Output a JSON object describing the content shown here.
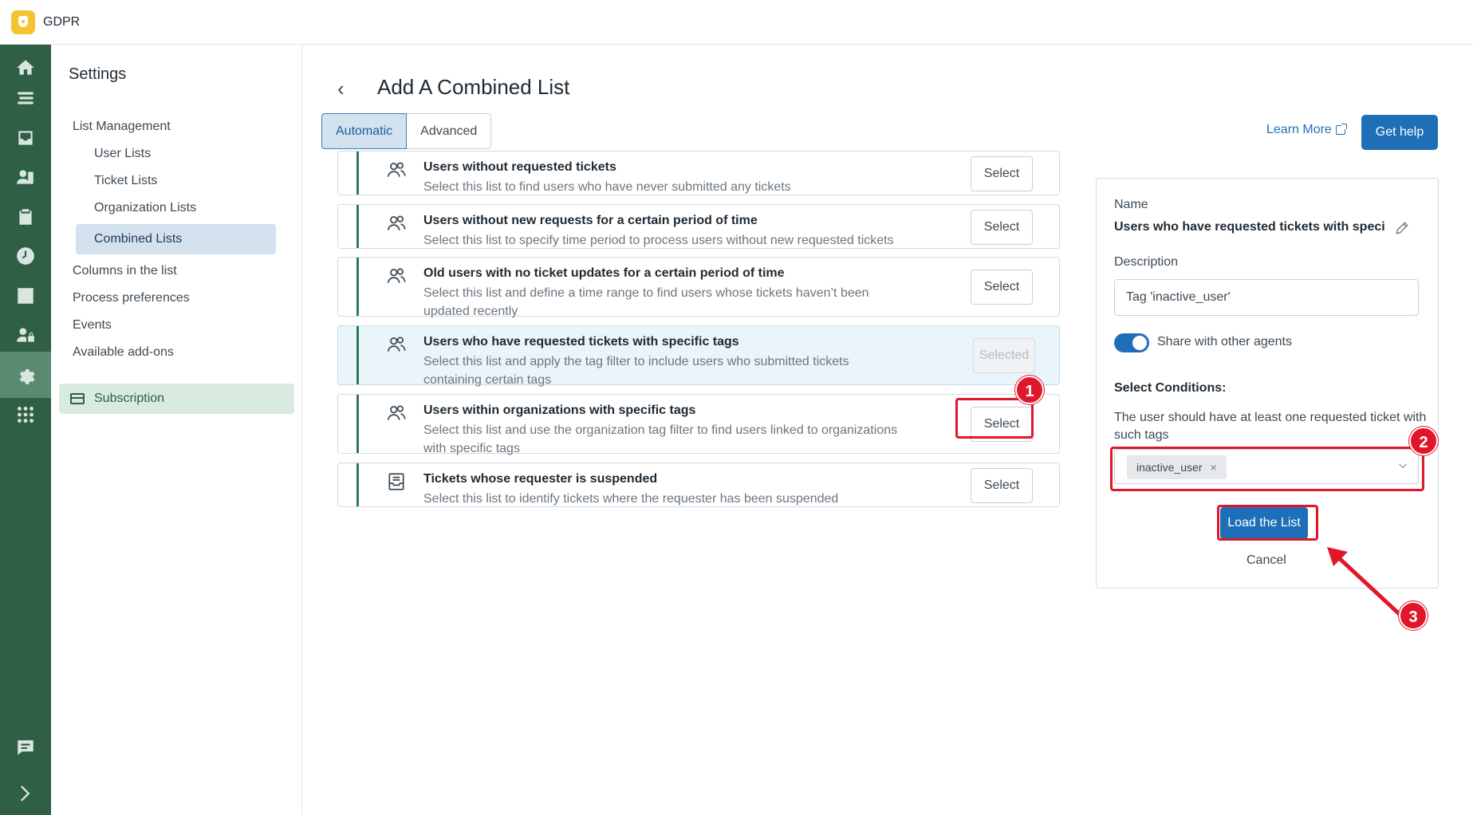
{
  "app": {
    "title": "GDPR"
  },
  "rail": {
    "items": [
      {
        "icon": "home-icon"
      },
      {
        "icon": "lists-icon"
      },
      {
        "icon": "inbox-icon"
      },
      {
        "icon": "users-icon"
      },
      {
        "icon": "clipboard-icon"
      },
      {
        "icon": "clock-icon"
      },
      {
        "icon": "chart-icon"
      },
      {
        "icon": "user-lock-icon"
      },
      {
        "icon": "gear-icon"
      },
      {
        "icon": "apps-grid-icon"
      },
      {
        "icon": "chat-icon"
      },
      {
        "icon": "expand-icon"
      }
    ]
  },
  "settings": {
    "title": "Settings",
    "items": {
      "list_management": "List Management",
      "user_lists": "User Lists",
      "ticket_lists": "Ticket Lists",
      "organization_lists": "Organization Lists",
      "combined_lists": "Combined Lists",
      "columns": "Columns in the list",
      "process_preferences": "Process preferences",
      "events": "Events",
      "addons": "Available add-ons",
      "subscription": "Subscription"
    }
  },
  "page": {
    "back": "‹",
    "title": "Add A Combined List",
    "tabs": [
      "Automatic",
      "Advanced"
    ],
    "learn_more": "Learn More",
    "get_help": "Get help"
  },
  "lists": [
    {
      "title": "Users without requested tickets",
      "desc": "Select this list to find users who have never submitted any tickets",
      "button": "Select",
      "icon": "users-icon"
    },
    {
      "title": "Users without new requests for a certain period of time",
      "desc": "Select this list to specify time period to process users without new requested tickets",
      "button": "Select",
      "icon": "users-icon"
    },
    {
      "title": "Old users with no ticket updates for a certain period of time",
      "desc": "Select this list and define a time range to find users whose tickets haven’t been updated recently",
      "button": "Select",
      "icon": "users-icon"
    },
    {
      "title": "Users who have requested tickets with specific tags",
      "desc": "Select this list and apply the tag filter to include users who submitted tickets containing certain tags",
      "button": "Selected",
      "icon": "users-icon"
    },
    {
      "title": "Users within organizations with specific tags",
      "desc": "Select this list and use the organization tag filter to find users linked to organizations with specific tags",
      "button": "Select",
      "icon": "users-icon"
    },
    {
      "title": "Tickets whose requester is suspended",
      "desc": "Select this list to identify tickets where the requester has been suspended",
      "button": "Select",
      "icon": "ticket-icon"
    }
  ],
  "panel": {
    "name_label": "Name",
    "name_value": "Users who have requested tickets with specifi...",
    "description_label": "Description",
    "description_value": "Tag 'inactive_user'",
    "share_label": "Share with other agents",
    "share_on": true,
    "conditions_title": "Select Conditions:",
    "conditions_desc": "The user should have at least one requested ticket with such tags",
    "tag": "inactive_user",
    "tag_remove": "×",
    "load_button": "Load the List",
    "cancel": "Cancel"
  },
  "annotations": {
    "b1": "1",
    "b2": "2",
    "b3": "3",
    "color": "#e0162b"
  }
}
